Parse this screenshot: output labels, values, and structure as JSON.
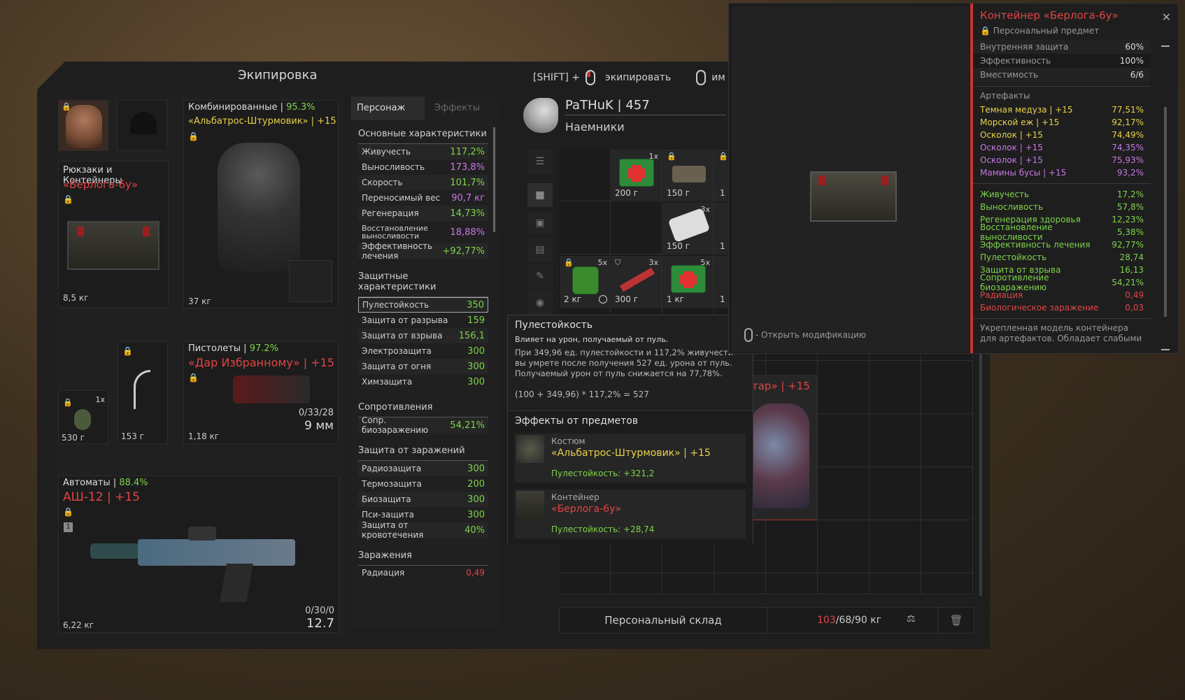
{
  "equipment": {
    "title": "Экипировка",
    "hint_shift": "[SHIFT] +",
    "hint_equip": "экипировать",
    "hint_other": "им",
    "backpack": {
      "category": "Рюкзаки и Контейнеры",
      "name": "«Берлога-6у»",
      "weight": "8,5 кг"
    },
    "armor": {
      "category": "Комбинированные",
      "percent": "95.3%",
      "name": "«Альбатрос-Штурмовик» | +15",
      "weight": "37 кг"
    },
    "pistol": {
      "category": "Пистолеты",
      "percent": "97.2%",
      "name": "«Дар Избранному» | +15",
      "weight": "1,18 кг",
      "ammo": "0/33/28",
      "caliber": "9 мм"
    },
    "grenade": {
      "count": "1x",
      "weight": "530 г"
    },
    "knife": {
      "weight": "153 г"
    },
    "rifle": {
      "category": "Автоматы",
      "percent": "88.4%",
      "name": "АШ-12 | +15",
      "weight": "6,22 кг",
      "ammo": "0/30/0",
      "caliber": "12.7",
      "slot_num": "1"
    }
  },
  "stats": {
    "tab_character": "Персонаж",
    "tab_effects": "Эффекты",
    "main_title": "Основные характеристики",
    "main": [
      {
        "label": "Живучесть",
        "value": "117,2%"
      },
      {
        "label": "Выносливость",
        "value": "173,8%"
      },
      {
        "label": "Скорость",
        "value": "101,7%"
      },
      {
        "label": "Переносимый вес",
        "value": "90,7 кг"
      },
      {
        "label": "Регенерация",
        "value": "14,73%"
      },
      {
        "label": "Восстановление выносливости",
        "value": "18,88%"
      },
      {
        "label": "Эффективность лечения",
        "value": "+92,77%"
      }
    ],
    "protect_title": "Защитные характеристики",
    "protect": [
      {
        "label": "Пулестойкость",
        "value": "350"
      },
      {
        "label": "Защита от разрыва",
        "value": "159"
      },
      {
        "label": "Защита от взрыва",
        "value": "156,1"
      },
      {
        "label": "Электрозащита",
        "value": "300"
      },
      {
        "label": "Защита от огня",
        "value": "300"
      },
      {
        "label": "Химзащита",
        "value": "300"
      }
    ],
    "resist_title": "Сопротивления",
    "resist": [
      {
        "label": "Сопр. биозаражению",
        "value": "54,21%"
      }
    ],
    "contam_title": "Защита от заражений",
    "contam": [
      {
        "label": "Радиозащита",
        "value": "300"
      },
      {
        "label": "Термозащита",
        "value": "200"
      },
      {
        "label": "Биозащита",
        "value": "300"
      },
      {
        "label": "Пси-защита",
        "value": "300"
      },
      {
        "label": "Защита от кровотечения",
        "value": "40%"
      }
    ],
    "infection_title": "Заражения",
    "infection_first": "Радиация",
    "infection_first_value": "0,49"
  },
  "player": {
    "name": "PaTHuK | 457",
    "faction": "Наемники"
  },
  "inventory": {
    "items": [
      {
        "count": "1x",
        "weight": "200 г"
      },
      {
        "count": "",
        "weight": "150 г"
      },
      {
        "count": "3x",
        "weight": "150 г"
      },
      {
        "count": "5x",
        "weight": "2 кг"
      },
      {
        "count": "3x",
        "weight": "300 г"
      },
      {
        "count": "5x",
        "weight": "1 кг"
      }
    ],
    "partial": [
      "1",
      "1",
      "1",
      "1"
    ],
    "hidden_text": "тар» | +15",
    "storage_label": "Персональный склад",
    "weight_current": "103",
    "weight_rest": "/68/90 кг"
  },
  "tooltip": {
    "title": "Пулестойкость",
    "subtitle": "Влияет на урон, получаемый от пуль.",
    "body": "При 349,96 ед. пулестойкости и 117,2% живучести вы умрете после получения 527 ед. урона от пуль. Получаемый урон от пуль снижается на 77,78%.",
    "formula": "(100 + 349,96) * 117,2% = 527",
    "effects_title": "Эффекты от предметов",
    "effects": [
      {
        "type": "Костюм",
        "name": "«Альбатрос-Штурмовик» | +15",
        "bonus": "Пулестойкость: +321,2"
      },
      {
        "type": "Контейнер",
        "name": "«Берлога-6у»",
        "bonus": "Пулестойкость: +28,74"
      }
    ]
  },
  "popup": {
    "title": "Контейнер «Берлога-6у»",
    "subtitle": "Персональный предмет",
    "open_mod": "- Открыть модификацию",
    "props": [
      {
        "label": "Внутренняя защита",
        "value": "60%"
      },
      {
        "label": "Эффективность",
        "value": "100%"
      },
      {
        "label": "Вместимость",
        "value": "6/6"
      }
    ],
    "artifacts_title": "Артефакты",
    "artifacts": [
      {
        "label": "Темная медуза | +15",
        "value": "77,51%",
        "color": "yellow"
      },
      {
        "label": "Морской еж | +15",
        "value": "92,17%",
        "color": "yellow"
      },
      {
        "label": "Осколок | +15",
        "value": "74,49%",
        "color": "yellow"
      },
      {
        "label": "Осколок | +15",
        "value": "74,35%",
        "color": "purple"
      },
      {
        "label": "Осколок | +15",
        "value": "75,93%",
        "color": "purple"
      },
      {
        "label": "Мамины бусы | +15",
        "value": "93,2%",
        "color": "purple"
      }
    ],
    "bonuses": [
      {
        "label": "Живучесть",
        "value": "17,2%",
        "color": "green"
      },
      {
        "label": "Выносливость",
        "value": "57,8%",
        "color": "green"
      },
      {
        "label": "Регенерация здоровья",
        "value": "12,23%",
        "color": "green"
      },
      {
        "label": "Восстановление выносливости",
        "value": "5,38%",
        "color": "green"
      },
      {
        "label": "Эффективность лечения",
        "value": "92,77%",
        "color": "green"
      },
      {
        "label": "Пулестойкость",
        "value": "28,74",
        "color": "green"
      },
      {
        "label": "Защита от взрыва",
        "value": "16,13",
        "color": "green"
      },
      {
        "label": "Сопротивление биозаражению",
        "value": "54,21%",
        "color": "green"
      },
      {
        "label": "Радиация",
        "value": "0,49",
        "color": "red"
      },
      {
        "label": "Биологическое заражение",
        "value": "0,03",
        "color": "red"
      }
    ],
    "description": "Укрепленная модель контейнера для артефактов. Обладает слабыми"
  },
  "icons": [
    "lock-icon",
    "mouse-icon",
    "close-icon",
    "trash-icon",
    "eagle-icon",
    "grid-icon",
    "list-icon"
  ],
  "colors": {
    "green": "#7fd44a",
    "red": "#e04545",
    "yellow": "#e8d24a",
    "purple": "#c779e6"
  }
}
